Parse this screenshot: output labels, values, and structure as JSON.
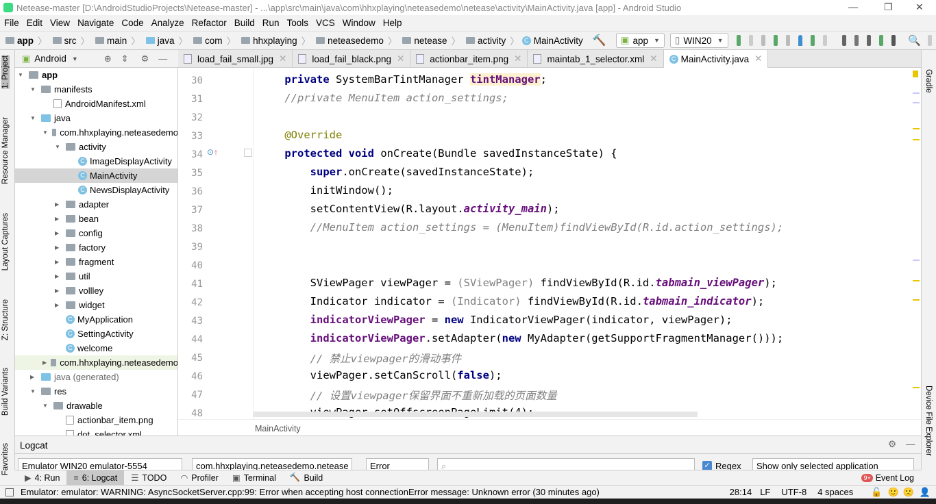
{
  "window": {
    "title": "Netease-master [D:\\AndroidStudioProjects\\Netease-master] - ...\\app\\src\\main\\java\\com\\hhxplaying\\neteasedemo\\netease\\activity\\MainActivity.java [app] - Android Studio"
  },
  "menu": [
    "File",
    "Edit",
    "View",
    "Navigate",
    "Code",
    "Analyze",
    "Refactor",
    "Build",
    "Run",
    "Tools",
    "VCS",
    "Window",
    "Help"
  ],
  "breadcrumb": [
    "app",
    "src",
    "main",
    "java",
    "com",
    "hhxplaying",
    "neteasedemo",
    "netease",
    "activity",
    "MainActivity"
  ],
  "toolbar": {
    "config": "app",
    "device": "WIN20"
  },
  "left_tabs": [
    "1: Project",
    "Resource Manager",
    "Layout Captures",
    "Z: Structure",
    "Build Variants",
    "Favorites"
  ],
  "right_tabs": [
    "Gradle",
    "Device File Explorer"
  ],
  "project": {
    "view": "Android",
    "tree": [
      {
        "label": "app",
        "depth": 0,
        "open": true,
        "kind": "module"
      },
      {
        "label": "manifests",
        "depth": 1,
        "open": true,
        "kind": "folder"
      },
      {
        "label": "AndroidManifest.xml",
        "depth": 2,
        "kind": "file"
      },
      {
        "label": "java",
        "depth": 1,
        "open": true,
        "kind": "folder-blue"
      },
      {
        "label": "com.hhxplaying.neteasedemo",
        "depth": 2,
        "open": true,
        "kind": "folder"
      },
      {
        "label": "activity",
        "depth": 3,
        "open": true,
        "kind": "folder"
      },
      {
        "label": "ImageDisplayActivity",
        "depth": 4,
        "kind": "class"
      },
      {
        "label": "MainActivity",
        "depth": 4,
        "kind": "class",
        "selected": true
      },
      {
        "label": "NewsDisplayActivity",
        "depth": 4,
        "kind": "class"
      },
      {
        "label": "adapter",
        "depth": 3,
        "kind": "folder"
      },
      {
        "label": "bean",
        "depth": 3,
        "kind": "folder"
      },
      {
        "label": "config",
        "depth": 3,
        "kind": "folder"
      },
      {
        "label": "factory",
        "depth": 3,
        "kind": "folder"
      },
      {
        "label": "fragment",
        "depth": 3,
        "kind": "folder"
      },
      {
        "label": "util",
        "depth": 3,
        "kind": "folder"
      },
      {
        "label": "vollley",
        "depth": 3,
        "kind": "folder"
      },
      {
        "label": "widget",
        "depth": 3,
        "kind": "folder"
      },
      {
        "label": "MyApplication",
        "depth": 3,
        "kind": "class"
      },
      {
        "label": "SettingActivity",
        "depth": 3,
        "kind": "class"
      },
      {
        "label": "welcome",
        "depth": 3,
        "kind": "class"
      },
      {
        "label": "com.hhxplaying.neteasedemo",
        "depth": 2,
        "kind": "folder",
        "highlight": true
      },
      {
        "label": "java (generated)",
        "depth": 1,
        "kind": "folder-blue"
      },
      {
        "label": "res",
        "depth": 1,
        "open": true,
        "kind": "folder"
      },
      {
        "label": "drawable",
        "depth": 2,
        "open": true,
        "kind": "folder"
      },
      {
        "label": "actionbar_item.png",
        "depth": 3,
        "kind": "file"
      },
      {
        "label": "dot_selector.xml",
        "depth": 3,
        "kind": "file"
      }
    ]
  },
  "editor_tabs": [
    {
      "label": "load_fail_small.jpg"
    },
    {
      "label": "load_fail_black.png"
    },
    {
      "label": "actionbar_item.png"
    },
    {
      "label": "maintab_1_selector.xml"
    },
    {
      "label": "MainActivity.java",
      "active": true
    }
  ],
  "code": [
    {
      "n": "30",
      "t": [
        [
          "    ",
          ""
        ],
        [
          "private ",
          "kw"
        ],
        [
          "SystemBarTintManager ",
          ""
        ],
        [
          "tintManager",
          "fd mk"
        ],
        [
          ";",
          ""
        ]
      ]
    },
    {
      "n": "31",
      "t": [
        [
          "    //private MenuItem action_settings;",
          "cm"
        ]
      ]
    },
    {
      "n": "32",
      "t": []
    },
    {
      "n": "33",
      "t": [
        [
          "    @Override",
          "an"
        ]
      ]
    },
    {
      "n": "34",
      "t": [
        [
          "    ",
          ""
        ],
        [
          "protected void ",
          "kw"
        ],
        [
          "onCreate(Bundle savedInstanceState) {",
          ""
        ]
      ]
    },
    {
      "n": "35",
      "t": [
        [
          "        ",
          ""
        ],
        [
          "super",
          "kw"
        ],
        [
          ".onCreate(savedInstanceState);",
          ""
        ]
      ]
    },
    {
      "n": "36",
      "t": [
        [
          "        initWindow();",
          ""
        ]
      ]
    },
    {
      "n": "37",
      "t": [
        [
          "        setContentView(R.layout.",
          ""
        ],
        [
          "activity_main",
          "sf"
        ],
        [
          ");",
          ""
        ]
      ]
    },
    {
      "n": "38",
      "t": [
        [
          "        //MenuItem action_settings = (MenuItem)findViewById(R.id.action_settings);",
          "cm"
        ]
      ]
    },
    {
      "n": "39",
      "t": []
    },
    {
      "n": "40",
      "t": []
    },
    {
      "n": "41",
      "t": [
        [
          "        SViewPager viewPager = ",
          ""
        ],
        [
          "(SViewPager)",
          "gy"
        ],
        [
          " findViewById(R.id.",
          ""
        ],
        [
          "tabmain_viewPager",
          "sf"
        ],
        [
          ");",
          ""
        ]
      ]
    },
    {
      "n": "42",
      "t": [
        [
          "        Indicator indicator = ",
          ""
        ],
        [
          "(Indicator)",
          "gy"
        ],
        [
          " findViewById(R.id.",
          ""
        ],
        [
          "tabmain_indicator",
          "sf"
        ],
        [
          ");",
          ""
        ]
      ]
    },
    {
      "n": "43",
      "t": [
        [
          "        ",
          ""
        ],
        [
          "indicatorViewPager",
          "fd"
        ],
        [
          " = ",
          ""
        ],
        [
          "new ",
          "kw"
        ],
        [
          "IndicatorViewPager(indicator, viewPager);",
          ""
        ]
      ]
    },
    {
      "n": "44",
      "t": [
        [
          "        ",
          ""
        ],
        [
          "indicatorViewPager",
          "fd"
        ],
        [
          ".setAdapter(",
          ""
        ],
        [
          "new ",
          "kw"
        ],
        [
          "MyAdapter(getSupportFragmentManager()));",
          ""
        ]
      ]
    },
    {
      "n": "45",
      "t": [
        [
          "        // 禁止viewpager的滑动事件",
          "cm"
        ]
      ]
    },
    {
      "n": "46",
      "t": [
        [
          "        viewPager.setCanScroll(",
          ""
        ],
        [
          "false",
          "kw"
        ],
        [
          ");",
          ""
        ]
      ]
    },
    {
      "n": "47",
      "t": [
        [
          "        // 设置viewpager保留界面不重新加载的页面数量",
          "cm"
        ]
      ]
    },
    {
      "n": "48",
      "t": [
        [
          "        viewPager.setOffscreenPageLimit(4);",
          ""
        ]
      ]
    }
  ],
  "editor_breadcrumb": "MainActivity",
  "logcat": {
    "title": "Logcat",
    "device": "Emulator WIN20 emulator-5554",
    "process": "com.hhxplaying.neteasedemo.netease",
    "level": "Error",
    "search": "",
    "regex_label": "Regex",
    "regex_checked": true,
    "filter": "Show only selected application"
  },
  "tool_windows": [
    {
      "label": "4: Run"
    },
    {
      "label": "6: Logcat",
      "active": true
    },
    {
      "label": "TODO"
    },
    {
      "label": "Profiler"
    },
    {
      "label": "Terminal"
    },
    {
      "label": "Build"
    }
  ],
  "event_log": {
    "label": "Event Log",
    "badge": "9+"
  },
  "status": {
    "message": "Emulator: emulator: WARNING: AsyncSocketServer.cpp:99: Error when accepting host connectionError message: Unknown error (30 minutes ago)",
    "position": "28:14",
    "line_sep": "LF",
    "encoding": "UTF-8",
    "indent": "4 spaces"
  },
  "colors": {
    "keyword": "#000080",
    "comment": "#808080",
    "field": "#660e7a",
    "annotation": "#808000"
  }
}
